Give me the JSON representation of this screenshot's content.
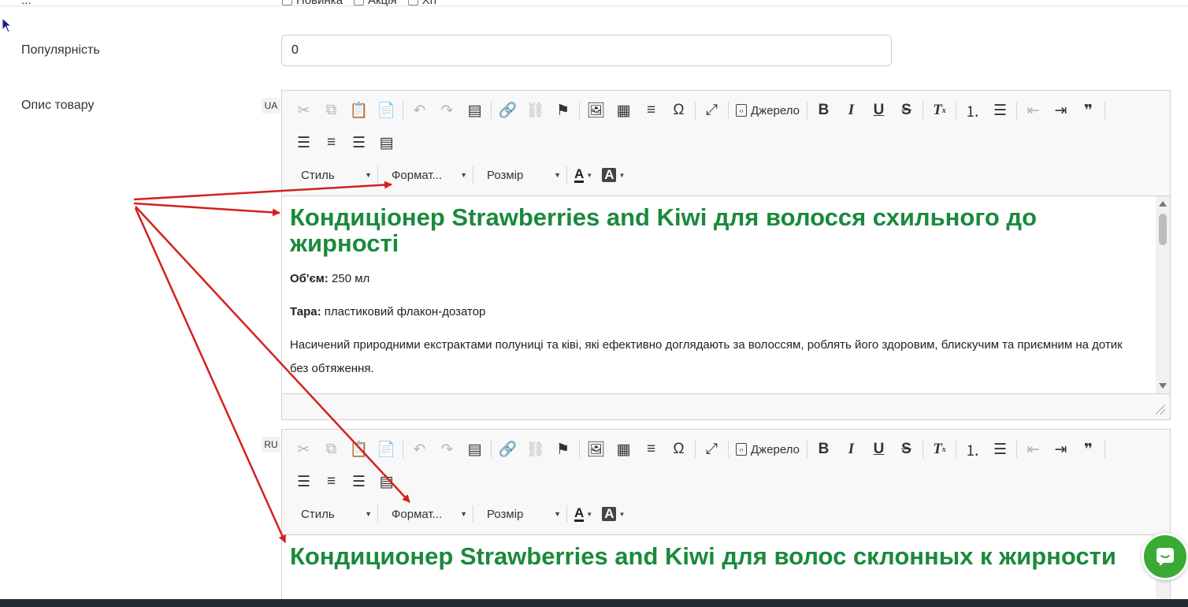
{
  "top_row": {
    "label_fragment": "...",
    "checkboxes": [
      "Новинка",
      "Акція",
      "Хіт"
    ]
  },
  "popularity": {
    "label": "Популярність",
    "value": "0"
  },
  "description": {
    "label": "Опис товару"
  },
  "toolbar": {
    "source_label": "Джерело",
    "style_combo": "Стиль",
    "format_combo": "Формат...",
    "size_combo": "Розмір",
    "text_color_glyph": "A",
    "bg_color_glyph": "A"
  },
  "editors": [
    {
      "lang": "UA",
      "heading": "Кондиціонер Strawberries and Kiwi для волосся схильного до жирності",
      "volume_label": "Об'єм:",
      "volume_value": " 250 мл",
      "tare_label": "Тара:",
      "tare_value": " пластиковий флакон-дозатор",
      "body": "Насичений природними екстрактами полуниці та ківі, які ефективно доглядають за волоссям, роблять його здоровим, блискучим та приємним на дотик без обтяження."
    },
    {
      "lang": "RU",
      "heading": "Кондиционер Strawberries and Kiwi для волос склонных к жирности"
    }
  ],
  "colors": {
    "heading_green": "#1a8a3c",
    "annotation_red": "#d42020",
    "chat_green": "#3aaa35"
  }
}
